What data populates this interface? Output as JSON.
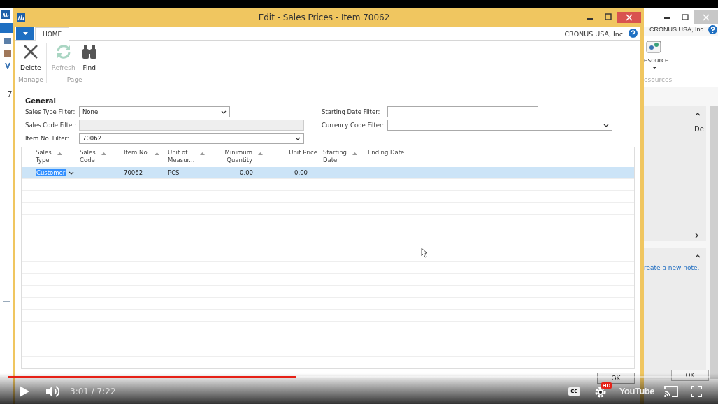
{
  "background_window": {
    "company": "CRONUS USA, Inc.",
    "left_number": "7",
    "ribbon_button": "esource",
    "ribbon_group": "esources",
    "factbox_text": "De",
    "note_link": "reate a new note.",
    "ok_button": "OK"
  },
  "dialog": {
    "title": "Edit - Sales Prices - Item 70062",
    "company": "CRONUS USA, Inc.",
    "tabs": [
      {
        "label": "HOME",
        "selected": true
      }
    ],
    "ribbon_groups": [
      {
        "label": "Manage",
        "actions": [
          {
            "label": "Delete",
            "kind": "delete",
            "disabled": false
          }
        ]
      },
      {
        "label": "Page",
        "actions": [
          {
            "label": "Refresh",
            "kind": "refresh",
            "disabled": true
          },
          {
            "label": "Find",
            "kind": "find",
            "disabled": false
          }
        ]
      }
    ],
    "section_title": "General",
    "left_filters": [
      {
        "label": "Sales Type Filter:",
        "value": "None",
        "kind": "dropdown",
        "disabled": false
      },
      {
        "label": "Sales Code Filter:",
        "kind": "text",
        "disabled": true
      },
      {
        "label": "Item No. Filter:",
        "value": "70062",
        "kind": "dropdown",
        "disabled": false
      }
    ],
    "right_filters": [
      {
        "label": "Starting Date Filter:",
        "kind": "text",
        "disabled": false
      },
      {
        "label": "Currency Code Filter:",
        "kind": "dropdown",
        "disabled": false
      }
    ],
    "table": {
      "columns": [
        {
          "lines": [
            "Sales",
            "Type"
          ],
          "sort_arrow": true
        },
        {
          "lines": [
            "Sales",
            "Code"
          ],
          "sort_arrow": true
        },
        {
          "lines": [
            "Item No."
          ],
          "sort_arrow": true
        },
        {
          "lines": [
            "Unit of",
            "Measur..."
          ],
          "sort_arrow": true
        },
        {
          "lines": [
            "Minimum",
            "Quantity"
          ],
          "sort_arrow": true
        },
        {
          "lines": [
            "Unit Price"
          ],
          "sort_arrow": false
        },
        {
          "lines": [
            "Starting",
            "Date"
          ],
          "sort_arrow": true
        },
        {
          "lines": [
            "Ending Date"
          ],
          "sort_arrow": false
        }
      ],
      "rows": [
        {
          "selected": true,
          "cells": [
            "Customer",
            null,
            "70062",
            "PCS",
            "0.00",
            "0.00",
            null,
            null
          ]
        }
      ]
    },
    "ok_button": "OK"
  },
  "player": {
    "progress": {
      "level": 0.41
    },
    "time": "3:01 / 7:22",
    "captions": "CC",
    "quality_badge": "HD",
    "logo": "YouTube"
  }
}
